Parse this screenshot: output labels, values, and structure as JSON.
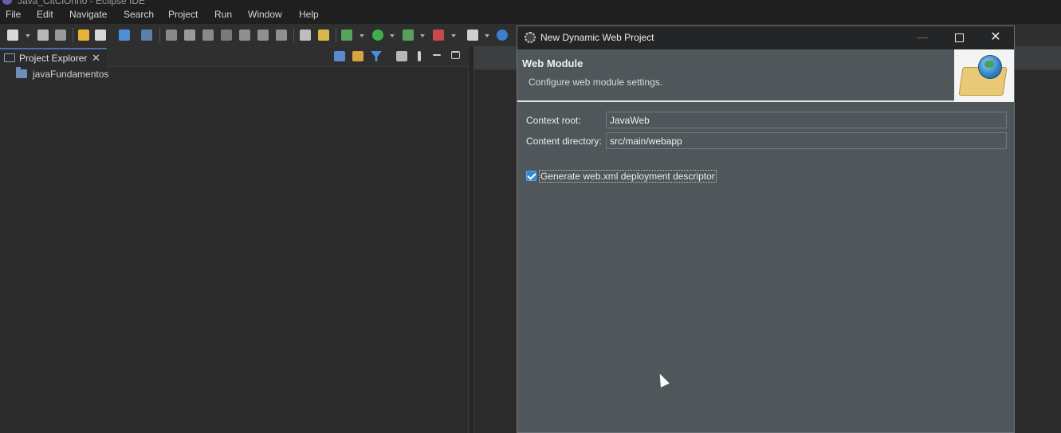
{
  "window": {
    "title": "Java_CitCiOnno - Eclipse IDE",
    "icon": "eclipse-icon"
  },
  "menu": {
    "items": [
      "File",
      "Edit",
      "Navigate",
      "Search",
      "Project",
      "Run",
      "Window",
      "Help"
    ]
  },
  "toolbar": {
    "icons": [
      "new-icon",
      "save-icon",
      "save-all-icon",
      "undo-icon",
      "redo-icon",
      "toggle-icon",
      "search-icon",
      "resume-icon",
      "suspend-icon",
      "terminate-icon",
      "disconnect-icon",
      "step-into-icon",
      "step-over-icon",
      "step-return-icon",
      "drop-to-frame-icon",
      "use-step-filters-icon",
      "debug-icon",
      "run-icon",
      "coverage-icon",
      "external-tools-icon",
      "server-icon",
      "spring-icon"
    ]
  },
  "explorer": {
    "tab_label": "Project Explorer",
    "close_glyph": "✕",
    "tools": [
      "collapse-all-icon",
      "link-with-editor-icon",
      "filter-icon",
      "focus-icon",
      "view-menu-icon",
      "minimize-icon",
      "maximize-icon"
    ],
    "items": [
      {
        "label": "javaFundamentos",
        "icon": "project-folder-icon"
      }
    ]
  },
  "dialog": {
    "title": "New Dynamic Web Project",
    "min_glyph": "—",
    "close_glyph": "✕",
    "banner_title": "Web Module",
    "banner_description": "Configure web module settings.",
    "context_root_label": "Context root:",
    "context_root_value": "JavaWeb",
    "content_dir_label": "Content directory:",
    "content_dir_value": "src/main/webapp",
    "generate_xml_label": "Generate web.xml deployment descriptor",
    "generate_xml_checked": true
  },
  "colors": {
    "accent": "#2f8ad4",
    "dialog_bg": "#50575b",
    "ide_bg": "#2b2b2b"
  }
}
